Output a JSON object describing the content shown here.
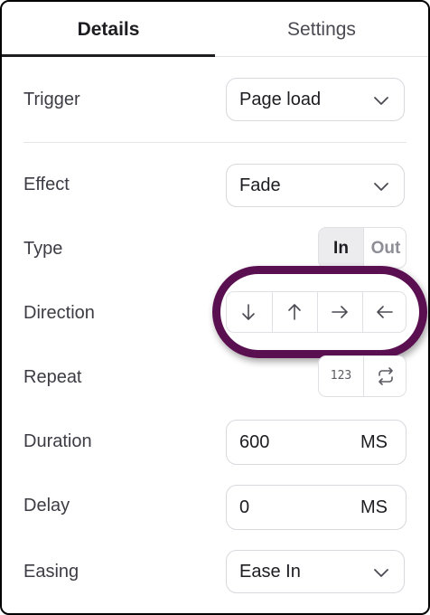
{
  "tabs": [
    {
      "label": "Details",
      "active": true
    },
    {
      "label": "Settings",
      "active": false
    }
  ],
  "trigger": {
    "label": "Trigger",
    "value": "Page load"
  },
  "effect": {
    "label": "Effect",
    "value": "Fade"
  },
  "type": {
    "label": "Type",
    "options": [
      "In",
      "Out"
    ],
    "selected": "In"
  },
  "direction": {
    "label": "Direction",
    "options": [
      "arrow-down-icon",
      "arrow-up-icon",
      "arrow-right-icon",
      "arrow-left-icon"
    ]
  },
  "repeat": {
    "label": "Repeat",
    "count_symbol": "123",
    "loop_icon": "repeat-icon"
  },
  "duration": {
    "label": "Duration",
    "value": "600",
    "unit": "MS"
  },
  "delay": {
    "label": "Delay",
    "value": "0",
    "unit": "MS"
  },
  "easing": {
    "label": "Easing",
    "value": "Ease In"
  },
  "colors": {
    "highlight_ring": "#5a1050",
    "text": "#1c1c21",
    "border": "#d8d8dd"
  }
}
